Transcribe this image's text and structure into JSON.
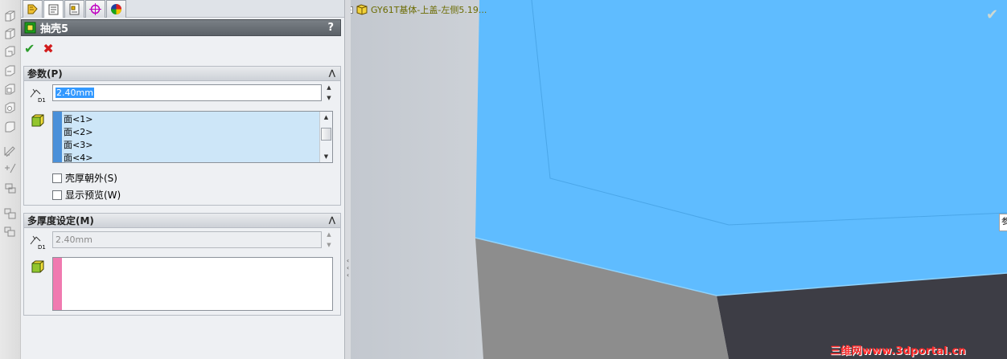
{
  "panel": {
    "title": "抽壳5",
    "help": "?",
    "ok_glyph": "✔",
    "cancel_glyph": "✖",
    "parameters": {
      "header": "参数(P)",
      "thickness_value_selected": "2.40mm",
      "dim_tag": "D1",
      "faces": [
        "面<1>",
        "面<2>",
        "面<3>",
        "面<4>"
      ],
      "face_list_color": "#4a90d9",
      "shell_outward_label": "壳厚朝外(S)",
      "shell_outward_checked": false,
      "show_preview_label": "显示预览(W)",
      "show_preview_checked": false
    },
    "multi_thickness": {
      "header": "多厚度设定(M)",
      "thickness_value": "2.40mm",
      "dim_tag": "D1",
      "faces": [],
      "face_list_color": "#f07ab0"
    }
  },
  "viewport": {
    "tree_node_label": "GY61T基体-上盖-左侧5.19...",
    "expander": "+",
    "edge_tab_label": "参",
    "watermark": "三维网www.3dportal.cn",
    "model_top_color": "#5fbcff",
    "model_side_color": "#8d8d8d",
    "model_dark_color": "#3d3d45"
  }
}
